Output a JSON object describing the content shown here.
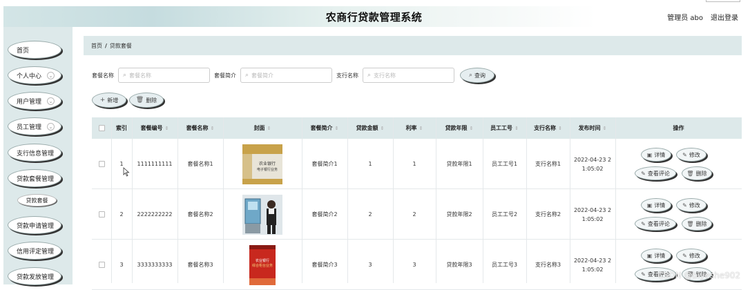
{
  "header": {
    "title": "农商行贷款管理系统",
    "admin": "管理员 abo",
    "logout": "退出登录"
  },
  "sidebar": {
    "items": [
      {
        "label": "首页",
        "has_chevron": false
      },
      {
        "label": "个人中心",
        "has_chevron": true
      },
      {
        "label": "用户管理",
        "has_chevron": true
      },
      {
        "label": "员工管理",
        "has_chevron": true
      },
      {
        "label": "支行信息管理",
        "has_chevron": false
      },
      {
        "label": "贷款套餐管理",
        "has_chevron": false
      },
      {
        "label": "贷款申请管理",
        "has_chevron": false
      },
      {
        "label": "信用评定管理",
        "has_chevron": false
      },
      {
        "label": "贷款发放管理",
        "has_chevron": false
      }
    ],
    "sub_item": "贷款套餐"
  },
  "breadcrumb": {
    "home": "首页",
    "separator": "/",
    "current": "贷款套餐"
  },
  "search": {
    "name_label": "套餐名称",
    "name_placeholder": "套餐名称",
    "intro_label": "套餐简介",
    "intro_placeholder": "套餐简介",
    "branch_label": "支行名称",
    "branch_placeholder": "支行名称",
    "query_button": "查询"
  },
  "toolbar": {
    "add_button": "新增",
    "delete_button": "删除"
  },
  "table": {
    "headers": [
      "索引",
      "套餐编号",
      "套餐名称",
      "封面",
      "套餐简介",
      "贷款金额",
      "利率",
      "贷款年限",
      "员工工号",
      "支行名称",
      "发布时间",
      "操作"
    ],
    "rows": [
      {
        "index": "1",
        "code": "1111111111",
        "name": "套餐名称1",
        "cover_text": "农业银行 电子银行业务",
        "intro": "套餐简介1",
        "amount": "1",
        "rate": "1",
        "years": "贷款年限1",
        "staff": "员工工号1",
        "branch": "支行名称1",
        "time_line1": "2022-04-23 2",
        "time_line2": "1:05:02"
      },
      {
        "index": "2",
        "code": "2222222222",
        "name": "套餐名称2",
        "cover_text": "",
        "intro": "套餐简介2",
        "amount": "2",
        "rate": "2",
        "years": "贷款年限2",
        "staff": "员工工号2",
        "branch": "支行名称2",
        "time_line1": "2022-04-23 2",
        "time_line2": "1:05:02"
      },
      {
        "index": "3",
        "code": "3333333333",
        "name": "套餐名称3",
        "cover_text": "农业银行 综合柜台业务",
        "intro": "套餐简介3",
        "amount": "3",
        "rate": "3",
        "years": "贷款年限3",
        "staff": "员工工号3",
        "branch": "支行名称3",
        "time_line1": "2022-04-23 2",
        "time_line2": "1:05:02"
      }
    ],
    "actions": {
      "detail": "详情",
      "edit": "修改",
      "comments": "查看评论",
      "delete": "删除"
    }
  },
  "watermark": "CSDN @biyeshe902"
}
